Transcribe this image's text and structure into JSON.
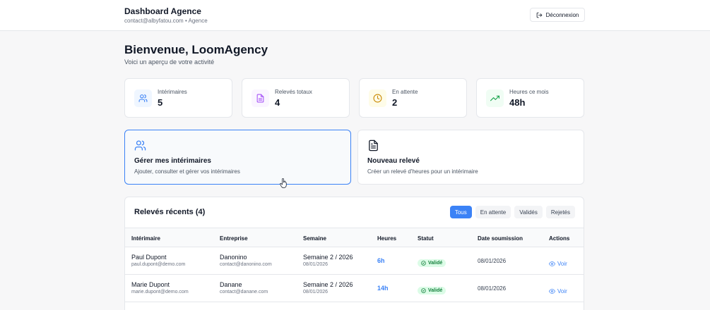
{
  "header": {
    "title": "Dashboard Agence",
    "subtitle": "contact@albyfatou.com • Agence",
    "logout_label": "Déconnexion"
  },
  "welcome": {
    "title": "Bienvenue, LoomAgency",
    "subtitle": "Voici un aperçu de votre activité"
  },
  "stats": [
    {
      "label": "Intérimaires",
      "value": "5",
      "icon": "users-icon",
      "color": "#3b82f6",
      "bg": "#eff6ff"
    },
    {
      "label": "Relevés totaux",
      "value": "4",
      "icon": "document-icon",
      "color": "#a855f7",
      "bg": "#faf5ff"
    },
    {
      "label": "En attente",
      "value": "2",
      "icon": "clock-icon",
      "color": "#ca8a04",
      "bg": "#fefce8"
    },
    {
      "label": "Heures ce mois",
      "value": "48h",
      "icon": "trending-up-icon",
      "color": "#16a34a",
      "bg": "#f0fdf4"
    }
  ],
  "actions": [
    {
      "title": "Gérer mes intérimaires",
      "description": "Ajouter, consulter et gérer vos intérimaires",
      "icon": "users-icon"
    },
    {
      "title": "Nouveau relevé",
      "description": "Créer un relevé d'heures pour un intérimaire",
      "icon": "document-icon"
    }
  ],
  "recent": {
    "title": "Relevés récents (4)",
    "filters": [
      "Tous",
      "En attente",
      "Validés",
      "Rejetés"
    ],
    "active_filter": "Tous",
    "columns": [
      "Intérimaire",
      "Entreprise",
      "Semaine",
      "Heures",
      "Statut",
      "Date soumission",
      "Actions"
    ],
    "rows": [
      {
        "name": "Paul Dupont",
        "email": "paul.dupont@demo.com",
        "company": "Danonino",
        "company_email": "contact@danonino.com",
        "week": "Semaine 2 / 2026",
        "week_date": "08/01/2026",
        "hours": "6h",
        "status": "Validé",
        "submitted": "08/01/2026",
        "action": "Voir"
      },
      {
        "name": "Marie Dupont",
        "email": "marie.dupont@demo.com",
        "company": "Danane",
        "company_email": "contact@danane.com",
        "week": "Semaine 2 / 2026",
        "week_date": "08/01/2026",
        "hours": "14h",
        "status": "Validé",
        "submitted": "08/01/2026",
        "action": "Voir"
      }
    ]
  },
  "colors": {
    "accent": "#3b82f6",
    "success": "#16a34a"
  }
}
